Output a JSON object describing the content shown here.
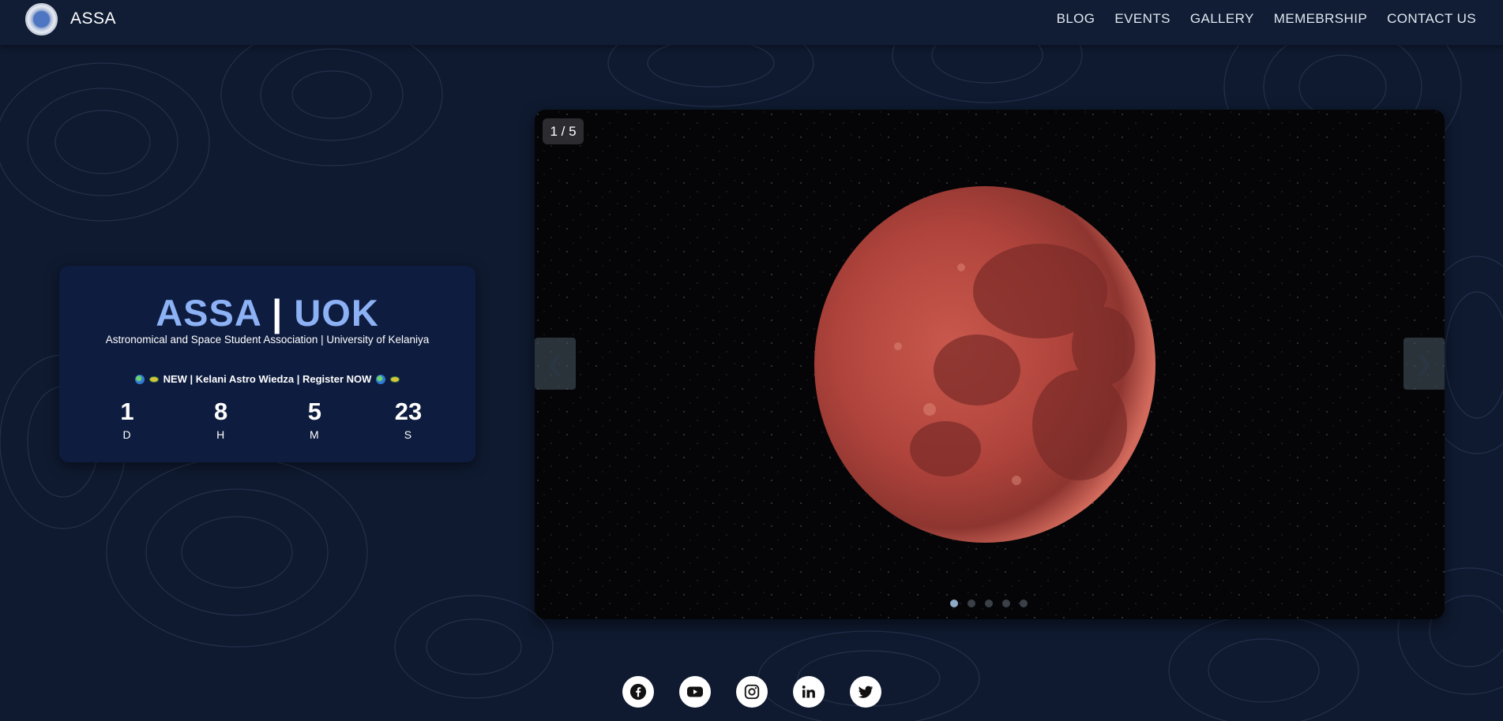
{
  "brand": {
    "name": "ASSA",
    "logo_icon": "assa-logo-icon"
  },
  "nav": {
    "items": [
      {
        "label": "BLOG"
      },
      {
        "label": "EVENTS"
      },
      {
        "label": "GALLERY"
      },
      {
        "label": "MEMEBRSHIP"
      },
      {
        "label": "CONTACT US"
      }
    ]
  },
  "hero": {
    "title_left": "ASSA",
    "title_sep": "|",
    "title_right": "UOK",
    "subtitle": "Astronomical and Space Student Association | University of Kelaniya",
    "announcement": "NEW | Kelani Astro Wiedza | Register NOW",
    "countdown": [
      {
        "value": "1",
        "label": "D"
      },
      {
        "value": "8",
        "label": "H"
      },
      {
        "value": "5",
        "label": "M"
      },
      {
        "value": "23",
        "label": "S"
      }
    ]
  },
  "slider": {
    "counter": "1 / 5",
    "prev_label": "❮",
    "next_label": "❯",
    "current_slide": 1,
    "total_slides": 5,
    "image_subject": "red moon in starry sky"
  },
  "socials": [
    {
      "icon": "facebook-icon"
    },
    {
      "icon": "youtube-icon"
    },
    {
      "icon": "instagram-icon"
    },
    {
      "icon": "linkedin-icon"
    },
    {
      "icon": "twitter-icon"
    }
  ],
  "colors": {
    "background": "#0f1a30",
    "navbar": "#101d35",
    "card": "#0e1c3f",
    "title_accent": "#8cb1f5",
    "moon": "#b8473f"
  }
}
